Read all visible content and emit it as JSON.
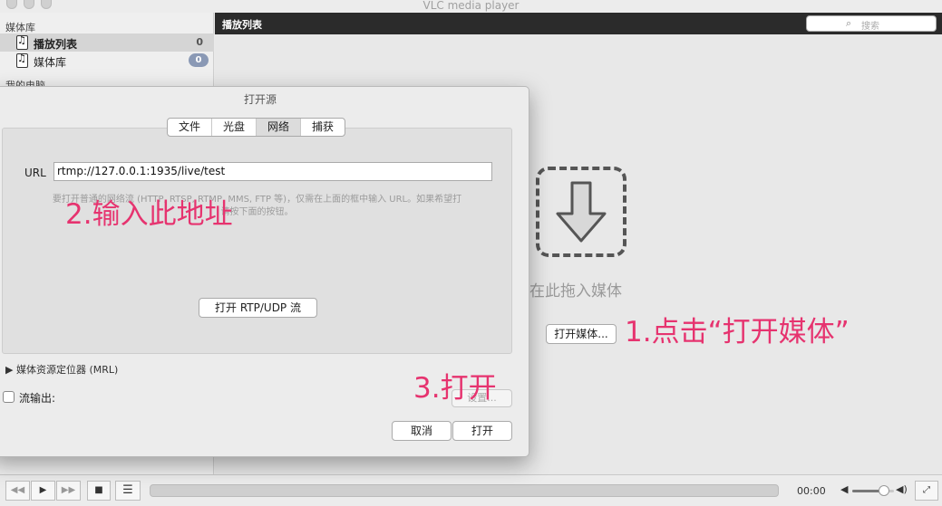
{
  "window": {
    "title": "VLC media player"
  },
  "sidebar": {
    "section_media": "媒体库",
    "items": [
      {
        "label": "播放列表",
        "count": "0"
      },
      {
        "label": "媒体库",
        "count": "0"
      }
    ],
    "section_computer": "我的电脑"
  },
  "main": {
    "header_title": "播放列表",
    "search_placeholder": "搜索",
    "drop_text": "在此拖入媒体",
    "open_media_button": "打开媒体..."
  },
  "dialog": {
    "title": "打开源",
    "tabs": [
      "文件",
      "光盘",
      "网络",
      "捕获"
    ],
    "active_tab": "网络",
    "url_label": "URL",
    "url_value": "rtmp://127.0.0.1:1935/live/test",
    "hint_line1": "要打开普通的网络流 (HTTP, RTSP, RTMP, MMS, FTP 等)，仅需在上面的框中输入 URL。如果希望打",
    "hint_line2": "请按下面的按钮。",
    "rtp_button": "打开 RTP/UDP 流",
    "mrl_label": "媒体资源定位器 (MRL)",
    "stream_output_label": "流输出:",
    "settings_button": "设置...",
    "cancel_button": "取消",
    "open_button": "打开"
  },
  "annotations": {
    "step1": "1.点击“打开媒体”",
    "step2": "2.输入此地址",
    "step3": "3.打开"
  },
  "controls": {
    "time": "00:00",
    "volume_level": 0.75
  },
  "colors": {
    "annotation": "#e6336f",
    "header_bg": "#2b2b2b",
    "badge": "#8a99b5"
  }
}
